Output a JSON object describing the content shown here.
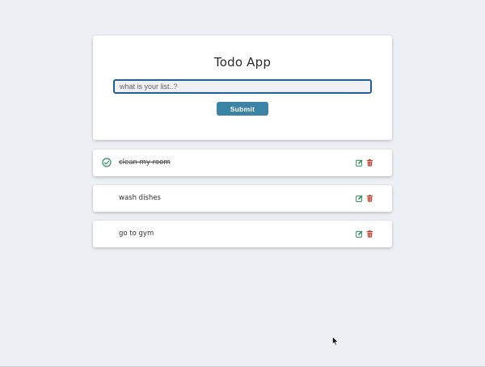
{
  "app": {
    "title": "Todo App"
  },
  "form": {
    "input_placeholder": "what is your list..?",
    "input_value": "",
    "submit_label": "Submit"
  },
  "todos": [
    {
      "text": "clean my room",
      "completed": true
    },
    {
      "text": "wash dishes",
      "completed": false
    },
    {
      "text": "go to gym",
      "completed": false
    }
  ],
  "colors": {
    "accent": "#3b84a5",
    "input_border": "#1f5f96",
    "check": "#2e8b57",
    "edit": "#2e8b57",
    "delete": "#c0392b",
    "background": "#eceff3"
  },
  "icons": {
    "complete": "check-circle-icon",
    "edit": "edit-icon",
    "delete": "trash-icon"
  }
}
